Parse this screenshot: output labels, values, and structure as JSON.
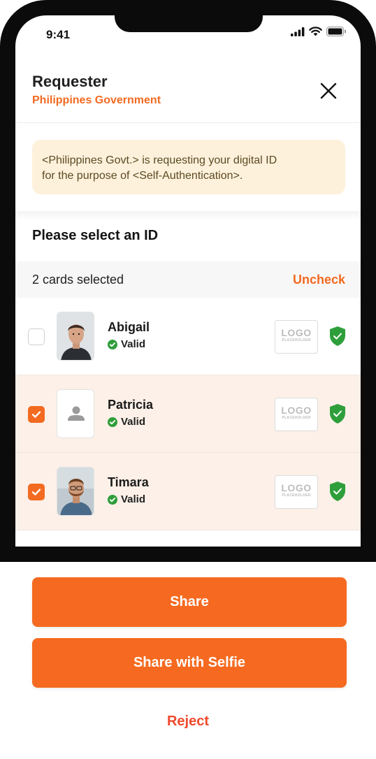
{
  "status_bar": {
    "time": "9:41"
  },
  "header": {
    "title": "Requester",
    "subtitle": "Philippines Government"
  },
  "notice": {
    "line1": "<Philippines Govt.> is requesting your digital ID",
    "line2": "for the purpose of <Self-Authentication>."
  },
  "section": {
    "title": "Please select an ID"
  },
  "selection": {
    "count_text": "2 cards selected",
    "uncheck_label": "Uncheck"
  },
  "cards": [
    {
      "name": "Abigail",
      "status": "Valid",
      "checked": false,
      "logo_main": "LOGO",
      "logo_sub": "PLACEHOLDER"
    },
    {
      "name": "Patricia",
      "status": "Valid",
      "checked": true,
      "logo_main": "LOGO",
      "logo_sub": "PLACEHOLDER"
    },
    {
      "name": "Timara",
      "status": "Valid",
      "checked": true,
      "logo_main": "LOGO",
      "logo_sub": "PLACEHOLDER"
    }
  ],
  "actions": {
    "share_label": "Share",
    "share_selfie_label": "Share with Selfie",
    "reject_label": "Reject"
  },
  "colors": {
    "accent": "#f36a21",
    "valid": "#2e9e3a",
    "reject": "#ef4a2e",
    "notice_bg": "#fdf1dc"
  },
  "icons": [
    "close-icon",
    "check-circle-icon",
    "shield-check-icon",
    "checkbox-check-icon",
    "user-placeholder-icon",
    "signal-icon",
    "wifi-icon",
    "battery-icon"
  ]
}
